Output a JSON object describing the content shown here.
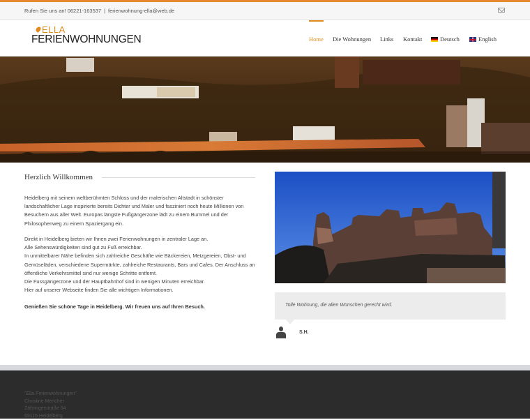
{
  "colors": {
    "accent": "#e08b1f",
    "footer_bg": "#2c2c2c",
    "topbar_bg": "#f6f6f6"
  },
  "topbar": {
    "phone": "Rufen Sie uns an! 06221-163537",
    "separator": "|",
    "email": "ferienwohnung-ella@web.de",
    "mail_icon": "envelope-icon"
  },
  "logo": {
    "line1": "ELLA",
    "line2": "FERIENWOHNUNGEN"
  },
  "nav": {
    "items": [
      {
        "label": "Home",
        "active": true
      },
      {
        "label": "Die Wohnungen"
      },
      {
        "label": "Links"
      },
      {
        "label": "Kontakt"
      },
      {
        "label": "Deutsch",
        "flag": "flag-de-icon"
      },
      {
        "label": "English",
        "flag": "flag-uk-icon"
      }
    ]
  },
  "main": {
    "title": "Herzlich Willkommen",
    "intro": [
      "Heidelberg mit seinem weltberühmten Schloss und der malerischen Altstadt in schönster",
      "landschaftlicher Lage inspirierte bereits Dichter und Maler und fasziniert noch heute Millionen von",
      "Besuchern aus aller Welt. Europas längste Fußgängerzone lädt zu einem Bummel und der",
      "Philosophenweg zu einem Spaziergang ein."
    ],
    "details": [
      "Direkt in Heidelberg bieten wir Ihnen zwei Ferienwohnungen in zentraler Lage an.",
      "Alle Sehenswürdigkeiten sind gut zu Fuß erreichbar.",
      "In unmittelbarer Nähe befinden sich zahlreiche Geschäfte wie Bäckereien, Metzgereien, Obst- und",
      "Gemüseläden, verschiedene Supermärkte, zahlreiche Restaurants, Bars und Cafes. Der Anschluss an",
      "öffentliche Verkehrsmittel sind nur wenige Schritte entfernt.",
      "Die Fussgängerzone und der Hauptbahnhof sind in wenigen Minuten erreichbar.",
      "Hier auf unserer Webseite finden Sie alle wichtigen Informationen."
    ],
    "closing": "Genießen Sie schöne Tage in Heidelberg. Wir freuen uns auf Ihren Besuch."
  },
  "testimonial": {
    "quote": "Tolle Wohnung, die allen Wünschen gerecht wird.",
    "author": "S.H.",
    "icon": "user-icon"
  },
  "footer": {
    "lines": [
      "\"Ella Ferienwohnungen\"",
      "Christine Mencher",
      "Zähringerstraße 54",
      "69115 Heidelberg"
    ]
  }
}
